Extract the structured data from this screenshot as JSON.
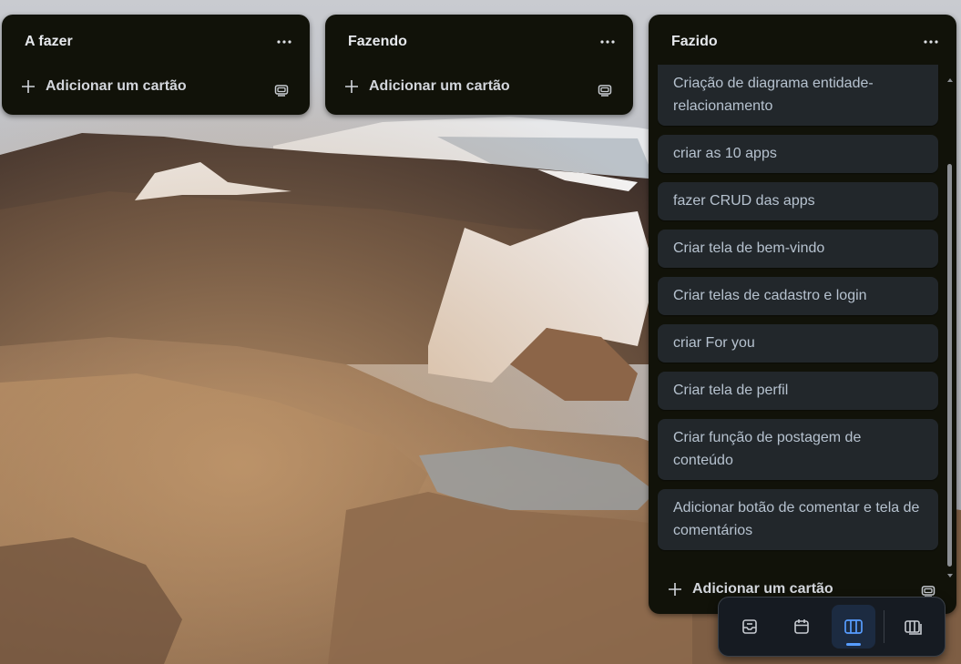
{
  "board": {
    "lists": [
      {
        "title": "A fazer",
        "add_card_label": "Adicionar um cartão"
      },
      {
        "title": "Fazendo",
        "add_card_label": "Adicionar um cartão"
      },
      {
        "title": "Fazido",
        "add_card_label": "Adicionar um cartão",
        "cards": [
          "Criação de diagrama entidade-relacionamento",
          "criar as 10 apps",
          "fazer CRUD das apps",
          "Criar tela de bem-vindo",
          "Criar telas de cadastro e login",
          "criar For you",
          "Criar tela de perfil",
          "Criar função de postagem de conteúdo",
          "Adicionar botão de comentar e tela de comentários"
        ]
      }
    ]
  },
  "icons": {
    "more": "more-horizontal-icon",
    "add": "plus-icon",
    "template": "card-template-icon",
    "inbox": "inbox-icon",
    "calendar": "calendar-icon",
    "board": "board-columns-icon",
    "switch_board": "switch-board-icon"
  },
  "view_switcher": {
    "buttons": [
      "inbox",
      "planner",
      "board",
      "switch-boards"
    ],
    "active": "board"
  },
  "colors": {
    "list_bg": "#111209",
    "card_bg": "#22272b",
    "card_text": "#b6c2cf",
    "accent": "#579dff",
    "switcher_bg": "#161b22"
  }
}
